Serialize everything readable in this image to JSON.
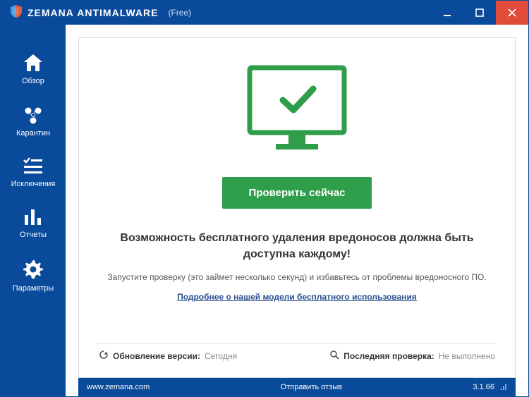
{
  "titlebar": {
    "brand_first": "ZEMANA",
    "brand_second": "ANTIMALWARE",
    "edition": "(Free)"
  },
  "sidebar": {
    "items": [
      {
        "label": "Обзор",
        "icon": "home-icon"
      },
      {
        "label": "Карантин",
        "icon": "biohazard-icon"
      },
      {
        "label": "Исключения",
        "icon": "checklist-icon"
      },
      {
        "label": "Отчеты",
        "icon": "bar-chart-icon"
      },
      {
        "label": "Параметры",
        "icon": "gear-icon"
      }
    ]
  },
  "main": {
    "scan_button": "Проверить сейчас",
    "headline": "Возможность бесплатного удаления вредоносов должна быть доступна каждому!",
    "subtext": "Запустите проверку (это займет несколько секунд) и избавьтесь от проблемы вредоносного ПО.",
    "link": "Подробнее о нашей модели бесплатного использования",
    "footer": {
      "update_label": "Обновление версии:",
      "update_value": "Сегодня",
      "lastscan_label": "Последняя проверка:",
      "lastscan_value": "Не выполнено"
    }
  },
  "bottombar": {
    "url": "www.zemana.com",
    "feedback": "Отправить отзыв",
    "version": "3.1.66"
  },
  "colors": {
    "brand_blue": "#0a4a9a",
    "accent_green": "#2e9e4a",
    "close_red": "#e04b3a"
  }
}
